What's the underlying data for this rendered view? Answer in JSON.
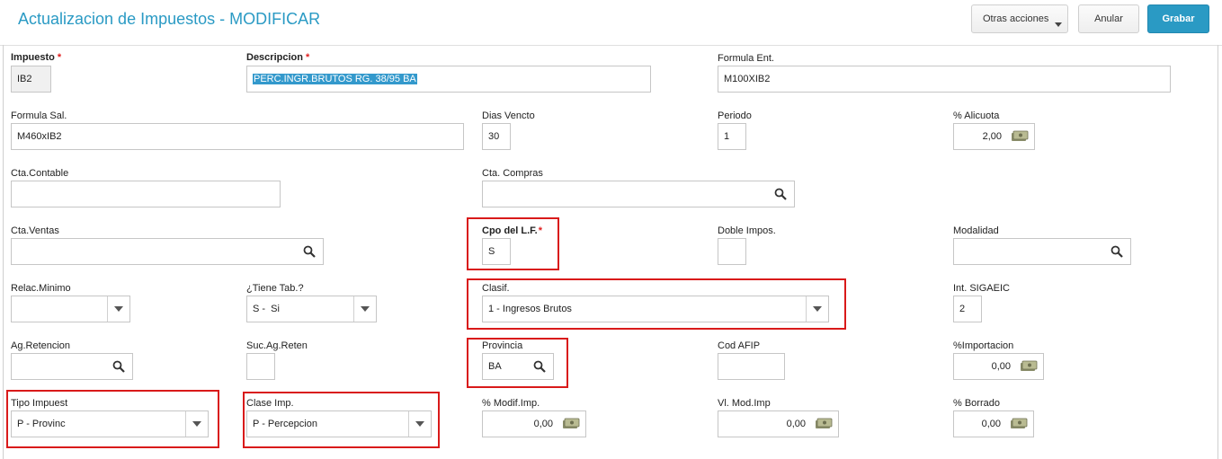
{
  "header": {
    "title": "Actualizacion de Impuestos - MODIFICAR",
    "otras_acciones": "Otras acciones",
    "anular": "Anular",
    "grabar": "Grabar"
  },
  "fields": {
    "impuesto": {
      "label": "Impuesto",
      "value": "IB2"
    },
    "descripcion": {
      "label": "Descripcion",
      "value": "PERC.INGR.BRUTOS RG. 38/95 BA"
    },
    "formula_ent": {
      "label": "Formula Ent.",
      "value": "M100XIB2"
    },
    "formula_sal": {
      "label": "Formula Sal.",
      "value": "M460xIB2"
    },
    "dias_vencto": {
      "label": "Dias Vencto",
      "value": "30"
    },
    "periodo": {
      "label": "Periodo",
      "value": "1"
    },
    "alicuota": {
      "label": "% Alicuota",
      "value": "2,00"
    },
    "cta_contable": {
      "label": "Cta.Contable",
      "value": ""
    },
    "cta_compras": {
      "label": "Cta. Compras",
      "value": ""
    },
    "cta_ventas": {
      "label": "Cta.Ventas",
      "value": ""
    },
    "cpo_lf": {
      "label": "Cpo del L.F.",
      "value": "S"
    },
    "doble_impos": {
      "label": "Doble Impos.",
      "value": ""
    },
    "modalidad": {
      "label": "Modalidad",
      "value": ""
    },
    "relac_minimo": {
      "label": "Relac.Minimo",
      "value": ""
    },
    "tiene_tab": {
      "label": "¿Tiene Tab.?",
      "value": "S -  Si"
    },
    "clasif": {
      "label": "Clasif.",
      "value": "1 - Ingresos Brutos"
    },
    "int_sigaeic": {
      "label": "Int. SIGAEIC",
      "value": "2"
    },
    "ag_retencion": {
      "label": "Ag.Retencion",
      "value": ""
    },
    "suc_ag_reten": {
      "label": "Suc.Ag.Reten",
      "value": ""
    },
    "provincia": {
      "label": "Provincia",
      "value": "BA"
    },
    "cod_afip": {
      "label": "Cod AFIP",
      "value": ""
    },
    "importacion": {
      "label": "%Importacion",
      "value": "0,00"
    },
    "tipo_impuest": {
      "label": "Tipo Impuest",
      "value": "P - Provinc"
    },
    "clase_imp": {
      "label": "Clase Imp.",
      "value": "P - Percepcion"
    },
    "modif_imp": {
      "label": "% Modif.Imp.",
      "value": "0,00"
    },
    "vl_mod_imp": {
      "label": "Vl. Mod.Imp",
      "value": "0,00"
    },
    "borrado": {
      "label": "% Borrado",
      "value": "0,00"
    }
  },
  "required_mark": "*",
  "colors": {
    "accent": "#2a9ac4",
    "required": "#e02020",
    "highlight": "#d91a1a"
  }
}
